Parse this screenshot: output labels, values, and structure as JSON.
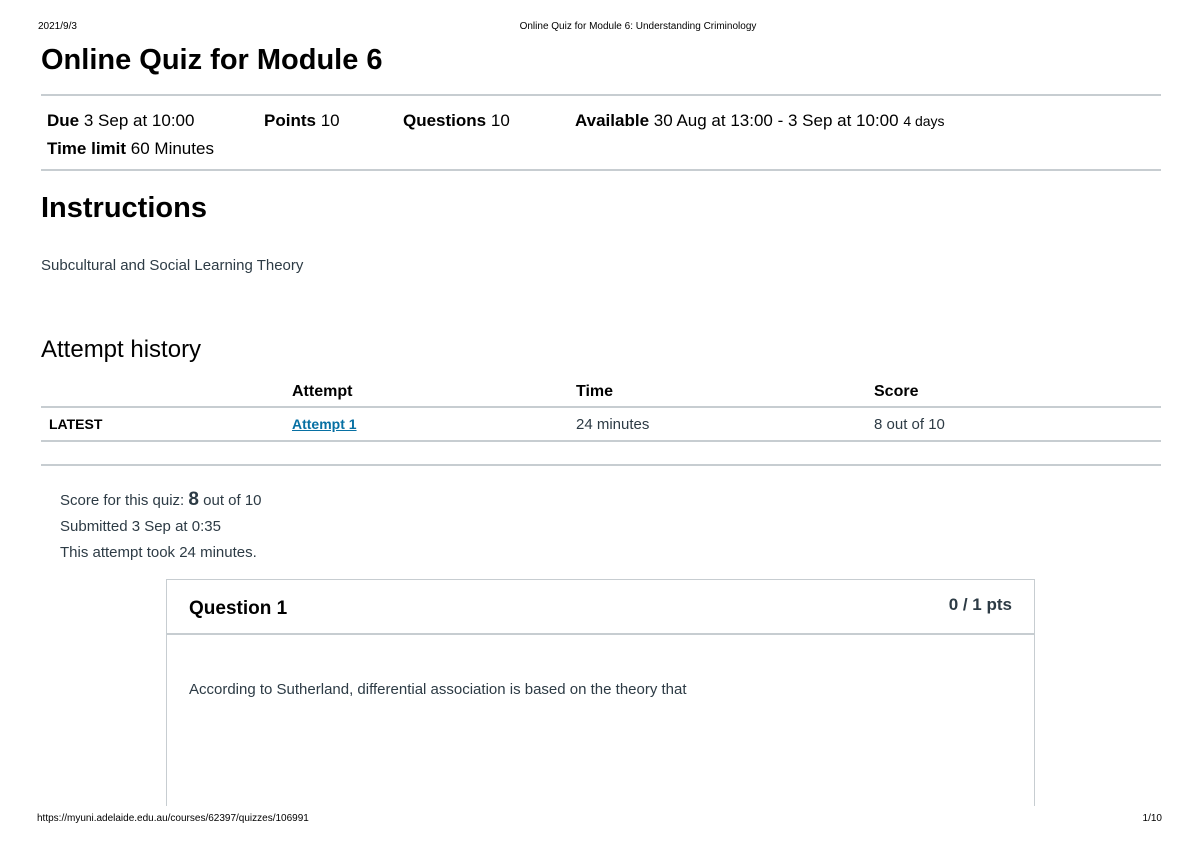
{
  "print_header": {
    "date": "2021/9/3",
    "title": "Online Quiz for Module 6: Understanding Criminology"
  },
  "quiz": {
    "title": "Online Quiz for Module 6"
  },
  "details": {
    "due_label": "Due",
    "due_value": "3 Sep at 10:00",
    "points_label": "Points",
    "points_value": "10",
    "questions_label": "Questions",
    "questions_value": "10",
    "available_label": "Available",
    "available_value": "30 Aug at 13:00 - 3 Sep at 10:00",
    "available_duration": "4 days",
    "time_limit_label": "Time limit",
    "time_limit_value": "60 Minutes"
  },
  "instructions": {
    "heading": "Instructions",
    "text": "Subcultural and Social Learning Theory"
  },
  "attempt_history": {
    "heading": "Attempt history",
    "columns": [
      "",
      "Attempt",
      "Time",
      "Score"
    ],
    "rows": [
      {
        "tag": "LATEST",
        "attempt": "Attempt 1 ",
        "time": "24 minutes",
        "score": "8 out of 10"
      }
    ]
  },
  "summary": {
    "score_prefix": "Score for this quiz: ",
    "score_value": "8",
    "score_suffix": " out of 10",
    "submitted": "Submitted 3 Sep at 0:35",
    "duration": "This attempt took 24 minutes."
  },
  "question": {
    "title": "Question 1",
    "points": "0 / 1 pts",
    "text": "According to Sutherland, differential association is based on the theory that"
  },
  "print_footer": {
    "url": "https://myuni.adelaide.edu.au/courses/62397/quizzes/106991",
    "page": "1/10"
  }
}
